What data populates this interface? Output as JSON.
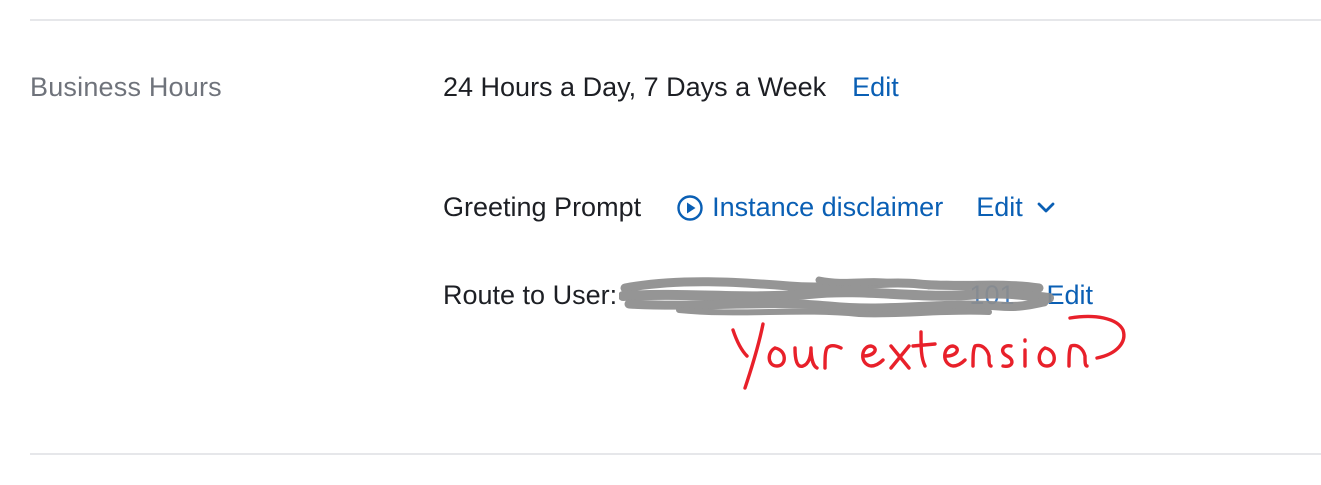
{
  "section": {
    "label": "Business Hours"
  },
  "business_hours": {
    "value": "24 Hours a Day, 7 Days a Week",
    "edit_label": "Edit"
  },
  "greeting": {
    "label": "Greeting Prompt",
    "prompt_name": "Instance disclaimer",
    "edit_label": "Edit",
    "icons": [
      "play-circle-icon",
      "chevron-down-icon"
    ]
  },
  "route": {
    "label": "Route to User:",
    "value_redacted": "101",
    "edit_label": "Edit"
  },
  "annotation": {
    "text": "Your extension",
    "color": "#e8202a"
  },
  "colors": {
    "link": "#0a5fb4",
    "label": "#6f737b",
    "text": "#1d1f24",
    "divider": "#e6e7ea"
  }
}
